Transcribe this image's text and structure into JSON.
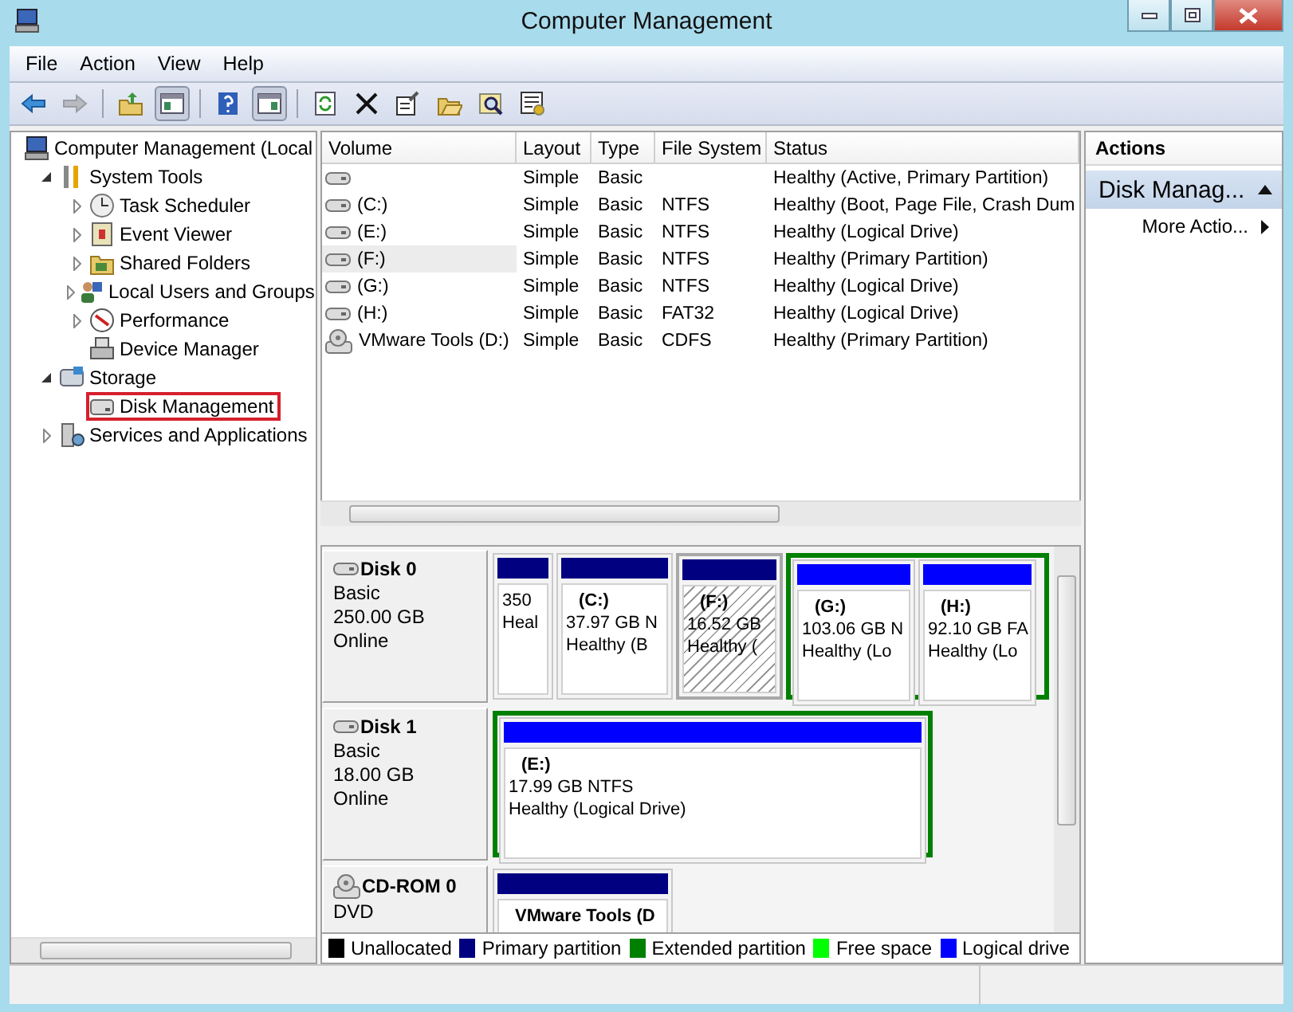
{
  "window": {
    "title": "Computer Management"
  },
  "menu": [
    "File",
    "Action",
    "View",
    "Help"
  ],
  "toolbar": [
    {
      "kind": "back",
      "disabled": false,
      "pressed": false
    },
    {
      "kind": "forward",
      "disabled": true,
      "pressed": false
    },
    {
      "kind": "up",
      "disabled": false,
      "pressed": false
    },
    {
      "kind": "tree-pane",
      "disabled": false,
      "pressed": true
    },
    {
      "kind": "help",
      "disabled": false,
      "pressed": false
    },
    {
      "kind": "action-pane",
      "disabled": false,
      "pressed": true
    },
    {
      "kind": "refresh",
      "disabled": false,
      "pressed": false
    },
    {
      "kind": "delete",
      "disabled": false,
      "pressed": false
    },
    {
      "kind": "properties",
      "disabled": false,
      "pressed": false
    },
    {
      "kind": "open",
      "disabled": false,
      "pressed": false
    },
    {
      "kind": "search",
      "disabled": false,
      "pressed": false
    },
    {
      "kind": "settings",
      "disabled": false,
      "pressed": false
    }
  ],
  "tree": [
    {
      "label": "Computer Management (Local",
      "selected": false,
      "children": [
        {
          "label": "System Tools",
          "expanded": true,
          "selected": false,
          "children": [
            {
              "label": "Task Scheduler",
              "expanded": false,
              "selected": false
            },
            {
              "label": "Event Viewer",
              "expanded": false,
              "selected": false
            },
            {
              "label": "Shared Folders",
              "expanded": false,
              "selected": false
            },
            {
              "label": "Local Users and Groups",
              "expanded": false,
              "selected": false
            },
            {
              "label": "Performance",
              "expanded": false,
              "selected": false
            },
            {
              "label": "Device Manager",
              "selected": false
            }
          ]
        },
        {
          "label": "Storage",
          "expanded": true,
          "selected": false,
          "children": [
            {
              "label": "Disk Management",
              "selected": true
            }
          ]
        },
        {
          "label": "Services and Applications",
          "expanded": false,
          "selected": false
        }
      ]
    }
  ],
  "volumes": {
    "columns": [
      "Volume",
      "Layout",
      "Type",
      "File System",
      "Status"
    ],
    "rows": [
      {
        "kind": "disk",
        "layout": "Simple",
        "type": "Basic",
        "status": "Healthy (Active, Primary Partition)",
        "selected": false
      },
      {
        "kind": "disk",
        "volume": "(C:)",
        "layout": "Simple",
        "type": "Basic",
        "file_system": "NTFS",
        "status": "Healthy (Boot, Page File, Crash Dum",
        "selected": false
      },
      {
        "kind": "disk",
        "volume": "(E:)",
        "layout": "Simple",
        "type": "Basic",
        "file_system": "NTFS",
        "status": "Healthy (Logical Drive)",
        "selected": false
      },
      {
        "kind": "disk",
        "volume": "(F:)",
        "layout": "Simple",
        "type": "Basic",
        "file_system": "NTFS",
        "status": "Healthy (Primary Partition)",
        "selected": true
      },
      {
        "kind": "disk",
        "volume": "(G:)",
        "layout": "Simple",
        "type": "Basic",
        "file_system": "NTFS",
        "status": "Healthy (Logical Drive)",
        "selected": false
      },
      {
        "kind": "disk",
        "volume": "(H:)",
        "layout": "Simple",
        "type": "Basic",
        "file_system": "FAT32",
        "status": "Healthy (Logical Drive)",
        "selected": false
      },
      {
        "kind": "cd",
        "volume": "VMware Tools (D:)",
        "layout": "Simple",
        "type": "Basic",
        "file_system": "CDFS",
        "status": "Healthy (Primary Partition)",
        "selected": false
      }
    ]
  },
  "disks": [
    {
      "kind": "disk",
      "name": "Disk 0",
      "type": "Basic",
      "size": "250.00 GB",
      "status": "Online",
      "partitions": [
        {
          "kind": "primary",
          "selected": false,
          "size": "350",
          "status": "Heal"
        },
        {
          "kind": "primary",
          "selected": false,
          "letter": "(C:)",
          "size": "37.97 GB N",
          "status": "Healthy (B"
        },
        {
          "kind": "primary",
          "selected": true,
          "letter": "(F:)",
          "size": "16.52 GB",
          "status": "Healthy ("
        },
        {
          "kind": "extended",
          "children": [
            {
              "kind": "logical",
              "selected": false,
              "letter": "(G:)",
              "size": "103.06 GB N",
              "status": "Healthy (Lo"
            },
            {
              "kind": "logical",
              "selected": false,
              "letter": "(H:)",
              "size": "92.10 GB FA",
              "status": "Healthy (Lo"
            }
          ]
        }
      ]
    },
    {
      "kind": "disk",
      "name": "Disk 1",
      "type": "Basic",
      "size": "18.00 GB",
      "status": "Online",
      "partitions": [
        {
          "kind": "extended",
          "children": [
            {
              "kind": "logical",
              "selected": false,
              "letter": "(E:)",
              "size": "17.99 GB NTFS",
              "status": "Healthy (Logical Drive)"
            }
          ]
        }
      ]
    },
    {
      "kind": "cd",
      "name": "CD-ROM 0",
      "type": "DVD",
      "partitions": [
        {
          "kind": "primary",
          "selected": false,
          "letter": "VMware Tools  (D"
        }
      ]
    }
  ],
  "legend": [
    {
      "label": "Unallocated",
      "color": "#000000"
    },
    {
      "label": "Primary partition",
      "color": "#000080"
    },
    {
      "label": "Extended partition",
      "color": "#008000"
    },
    {
      "label": "Free space",
      "color": "#00ff00"
    },
    {
      "label": "Logical drive",
      "color": "#0000ff"
    }
  ],
  "actions": {
    "title": "Actions",
    "sections": [
      {
        "label": "Disk Manag...",
        "expanded": true,
        "items": [
          "More Actio..."
        ]
      }
    ]
  }
}
